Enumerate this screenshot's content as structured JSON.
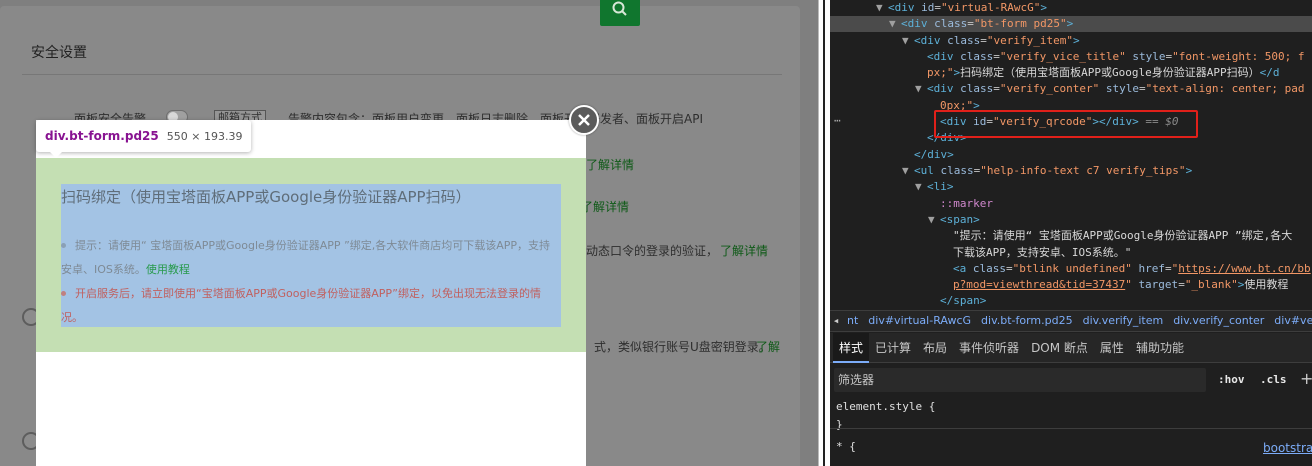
{
  "page": {
    "section_title": "安全设置",
    "bg_rows": [
      {
        "label": "面板安全告警",
        "pill": "邮箱方式",
        "desc": "告警内容包含：面板用户变更、面板日志删除、面板开启开发者、面板开启API"
      },
      {
        "link": "了解详情"
      },
      {
        "link": "了解详情"
      },
      {
        "desc": "动态口令的登录的验证，",
        "link": "了解详情"
      },
      {
        "desc": "式，类似银行账号U盘密钥登录。",
        "link": "了解"
      }
    ]
  },
  "modal": {
    "title": "扫码绑定（使用宝塔面板APP或Google身份验证器APP扫码）",
    "tip1_text": "提示：请使用“ 宝塔面板APP或Google身份验证器APP ”绑定,各大软件商店均可下载该APP，支持安卓、IOS系统。",
    "tip1_link": "使用教程",
    "tip2_text": "开启服务后，请立即使用“宝塔面板APP或Google身份验证器APP”绑定，以免出现无法登录的情况。"
  },
  "inspect_tooltip": {
    "selector": "div.bt-form.pd25",
    "dimensions": "550 × 193.39"
  },
  "devtools": {
    "dom_lines": [
      {
        "indent": 4,
        "tri": "▼",
        "html": "<span class='tag'>&lt;div</span> <span class='attr'>id</span>=<span class='val'>\"virtual-RAwcG\"</span><span class='tag'>&gt;</span>"
      },
      {
        "indent": 5,
        "tri": "▼",
        "sel": true,
        "html": "<span class='tag'>&lt;div</span> <span class='attr'>class</span>=<span class='val'>\"bt-form pd25\"</span><span class='tag'>&gt;</span>"
      },
      {
        "indent": 6,
        "tri": "▼",
        "html": "<span class='tag'>&lt;div</span> <span class='attr'>class</span>=<span class='val'>\"verify_item\"</span><span class='tag'>&gt;</span>"
      },
      {
        "indent": 7,
        "tri": "",
        "html": "<span class='tag'>&lt;div</span> <span class='attr'>class</span>=<span class='val'>\"verify_vice_title\"</span> <span class='attr'>style</span>=<span class='val'>\"font-weight: 500; f</span>"
      },
      {
        "indent": 7,
        "tri": "",
        "html": "<span class='val'>px;\"</span><span class='tag'>&gt;</span><span class='txt'>扫码绑定（使用宝塔面板APP或Google身份验证器APP扫码）</span><span class='tag'>&lt;/d</span>"
      },
      {
        "indent": 7,
        "tri": "▼",
        "html": "<span class='tag'>&lt;div</span> <span class='attr'>class</span>=<span class='val'>\"verify_conter\"</span> <span class='attr'>style</span>=<span class='val'>\"text-align: center; pad</span>"
      },
      {
        "indent": 8,
        "tri": "",
        "html": "<span class='val'>0px;\"</span><span class='tag'>&gt;</span>"
      },
      {
        "indent": 8,
        "tri": "",
        "html": "<span class='tag'>&lt;div</span> <span class='attr'>id</span>=<span class='val'>\"verify_qrcode\"</span><span class='tag'>&gt;&lt;/div&gt;</span> <span class='eq0'>== $0</span>"
      },
      {
        "indent": 7,
        "tri": "",
        "html": "<span class='tag'>&lt;/div&gt;</span>"
      },
      {
        "indent": 6,
        "tri": "",
        "html": "<span class='tag'>&lt;/div&gt;</span>"
      },
      {
        "indent": 6,
        "tri": "▼",
        "html": "<span class='tag'>&lt;ul</span> <span class='attr'>class</span>=<span class='val'>\"help-info-text c7 verify_tips\"</span><span class='tag'>&gt;</span>"
      },
      {
        "indent": 7,
        "tri": "▼",
        "html": "<span class='tag'>&lt;li&gt;</span>"
      },
      {
        "indent": 8,
        "tri": "",
        "html": "<span class='pseudo'>::marker</span>"
      },
      {
        "indent": 8,
        "tri": "▼",
        "html": "<span class='tag'>&lt;span&gt;</span>"
      },
      {
        "indent": 9,
        "tri": "",
        "html": "<span class='txt'>\"提示：请使用“ 宝塔面板APP或Google身份验证器APP ”绑定,各大</span>"
      },
      {
        "indent": 9,
        "tri": "",
        "html": "<span class='txt'>下载该APP，支持安卓、IOS系统。\"</span>"
      },
      {
        "indent": 9,
        "tri": "",
        "html": "<span class='tag'>&lt;a</span> <span class='attr'>class</span>=<span class='val'>\"btlink undefined\"</span> <span class='attr'>href</span>=<span class='val'>\"<span class='link-url'>https://www.bt.cn/bb</span></span>"
      },
      {
        "indent": 9,
        "tri": "",
        "html": "<span class='val'><span class='link-url'>p?mod=viewthread&amp;tid=37437</span>\"</span> <span class='attr'>target</span>=<span class='val'>\"_blank\"</span><span class='tag'>&gt;</span><span class='txt'>使用教程</span>"
      },
      {
        "indent": 8,
        "tri": "",
        "html": "<span class='tag'>&lt;/span&gt;</span>"
      }
    ],
    "breadcrumbs": [
      "nt",
      "div#virtual-RAwcG",
      "div.bt-form.pd25",
      "div.verify_item",
      "div.verify_conter",
      "div#ve"
    ],
    "tabs": [
      "样式",
      "已计算",
      "布局",
      "事件侦听器",
      "DOM 断点",
      "属性",
      "辅助功能"
    ],
    "filter_placeholder": "筛选器",
    "hov": ":hov",
    "cls": ".cls",
    "plus": "+",
    "element_style": "element.style {",
    "close_brace": "}",
    "star_rule": "* {",
    "bootstrap": "bootstra"
  }
}
